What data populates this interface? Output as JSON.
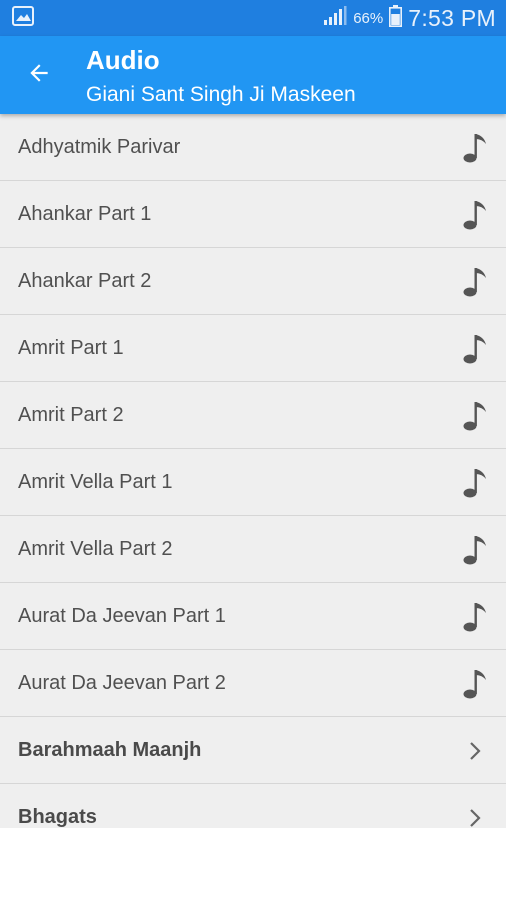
{
  "status_bar": {
    "battery_percent": "66%",
    "time": "7:53 PM",
    "icons": [
      "gallery-notification-icon",
      "signal-icon",
      "battery-icon"
    ]
  },
  "app_bar": {
    "title": "Audio",
    "subtitle": "Giani Sant Singh Ji Maskeen",
    "back_icon": "arrow-back-icon"
  },
  "colors": {
    "status_bar": "#1f7fe0",
    "app_bar": "#2196f3",
    "list_background": "#efefef",
    "divider": "#d6d6d6",
    "text": "#505050"
  },
  "items": [
    {
      "label": "Adhyatmik Parivar",
      "type": "audio",
      "icon": "music-note-icon"
    },
    {
      "label": "Ahankar Part 1",
      "type": "audio",
      "icon": "music-note-icon"
    },
    {
      "label": "Ahankar Part 2",
      "type": "audio",
      "icon": "music-note-icon"
    },
    {
      "label": "Amrit Part 1",
      "type": "audio",
      "icon": "music-note-icon"
    },
    {
      "label": "Amrit Part 2",
      "type": "audio",
      "icon": "music-note-icon"
    },
    {
      "label": "Amrit Vella Part 1",
      "type": "audio",
      "icon": "music-note-icon"
    },
    {
      "label": "Amrit Vella Part 2",
      "type": "audio",
      "icon": "music-note-icon"
    },
    {
      "label": "Aurat Da Jeevan Part 1",
      "type": "audio",
      "icon": "music-note-icon"
    },
    {
      "label": "Aurat Da Jeevan Part 2",
      "type": "audio",
      "icon": "music-note-icon"
    },
    {
      "label": "Barahmaah Maanjh",
      "type": "folder",
      "icon": "chevron-right-icon"
    },
    {
      "label": "Bhagats",
      "type": "folder",
      "icon": "chevron-right-icon"
    }
  ]
}
